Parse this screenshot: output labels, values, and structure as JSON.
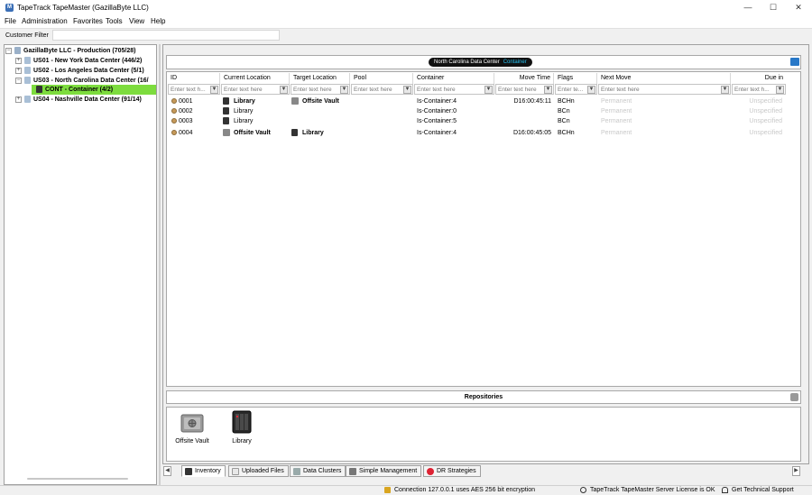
{
  "window": {
    "title": "TapeTrack TapeMaster (GazillaByte LLC)",
    "icon_letter": "M",
    "controls": {
      "minimize": "—",
      "maximize": "☐",
      "close": "✕"
    }
  },
  "menu": [
    "File",
    "Administration",
    "Favorites",
    "Tools",
    "View",
    "Help"
  ],
  "customer_filter": {
    "label": "Customer Filter",
    "value": "",
    "placeholder": ""
  },
  "tree": {
    "root": {
      "label": "GazillaByte LLC - Production (705/28)",
      "expander": "−"
    },
    "items": [
      {
        "label": "US01 - New York Data Center (446/2)",
        "expander": "+"
      },
      {
        "label": "US02 - Los Angeles Data Center (5/1)",
        "expander": "+"
      },
      {
        "label": "US03 - North Carolina Data Center (16/",
        "expander": "−"
      },
      {
        "label": "CONT - Container (4/2)",
        "expander": ""
      },
      {
        "label": "US04 - Nashville Data Center (91/14)",
        "expander": "+"
      }
    ]
  },
  "header_pill": {
    "name": "North Carolina Data Center",
    "type": "Container"
  },
  "grid": {
    "columns": [
      "ID",
      "Current Location",
      "Target Location",
      "Pool",
      "Container",
      "Move Time",
      "Flags",
      "Next Move",
      "Due in"
    ],
    "filter_placeholders": [
      "Enter text h...",
      "Enter text here",
      "Enter text here",
      "Enter text here",
      "Enter text here",
      "Enter text here",
      "Enter te...",
      "Enter text here",
      "Enter text h..."
    ],
    "rows": [
      {
        "id": "0001",
        "current": "Library",
        "target": "Offsite Vault",
        "pool": "",
        "container": "Is-Container:4",
        "move_time": "D16:00:45:11",
        "flags": "BCHn",
        "next_move": "Permanent",
        "due_in": "Unspecified"
      },
      {
        "id": "0002",
        "current": "Library",
        "target": "",
        "pool": "",
        "container": "Is-Container:0",
        "move_time": "",
        "flags": "BCn",
        "next_move": "Permanent",
        "due_in": "Unspecified"
      },
      {
        "id": "0003",
        "current": "Library",
        "target": "",
        "pool": "",
        "container": "Is-Container:5",
        "move_time": "",
        "flags": "BCn",
        "next_move": "Permanent",
        "due_in": "Unspecified"
      },
      {
        "id": "0004",
        "current": "Offsite Vault",
        "target": "Library",
        "pool": "",
        "container": "Is-Container:4",
        "move_time": "D16:00:45:05",
        "flags": "BCHn",
        "next_move": "Permanent",
        "due_in": "Unspecified"
      }
    ]
  },
  "repositories": {
    "title": "Repositories",
    "items": [
      "Offsite Vault",
      "Library"
    ]
  },
  "tabs": [
    "Inventory",
    "Uploaded Files",
    "Data Clusters",
    "Simple Management",
    "DR Strategies"
  ],
  "status": {
    "connection": "Connection 127.0.0.1 uses AES 256 bit encryption",
    "license": "TapeTrack TapeMaster Server License is OK",
    "support": "Get Technical Support"
  },
  "colors": {
    "selection_green": "#7ddc3e",
    "pill_accent": "#27c1f0"
  }
}
